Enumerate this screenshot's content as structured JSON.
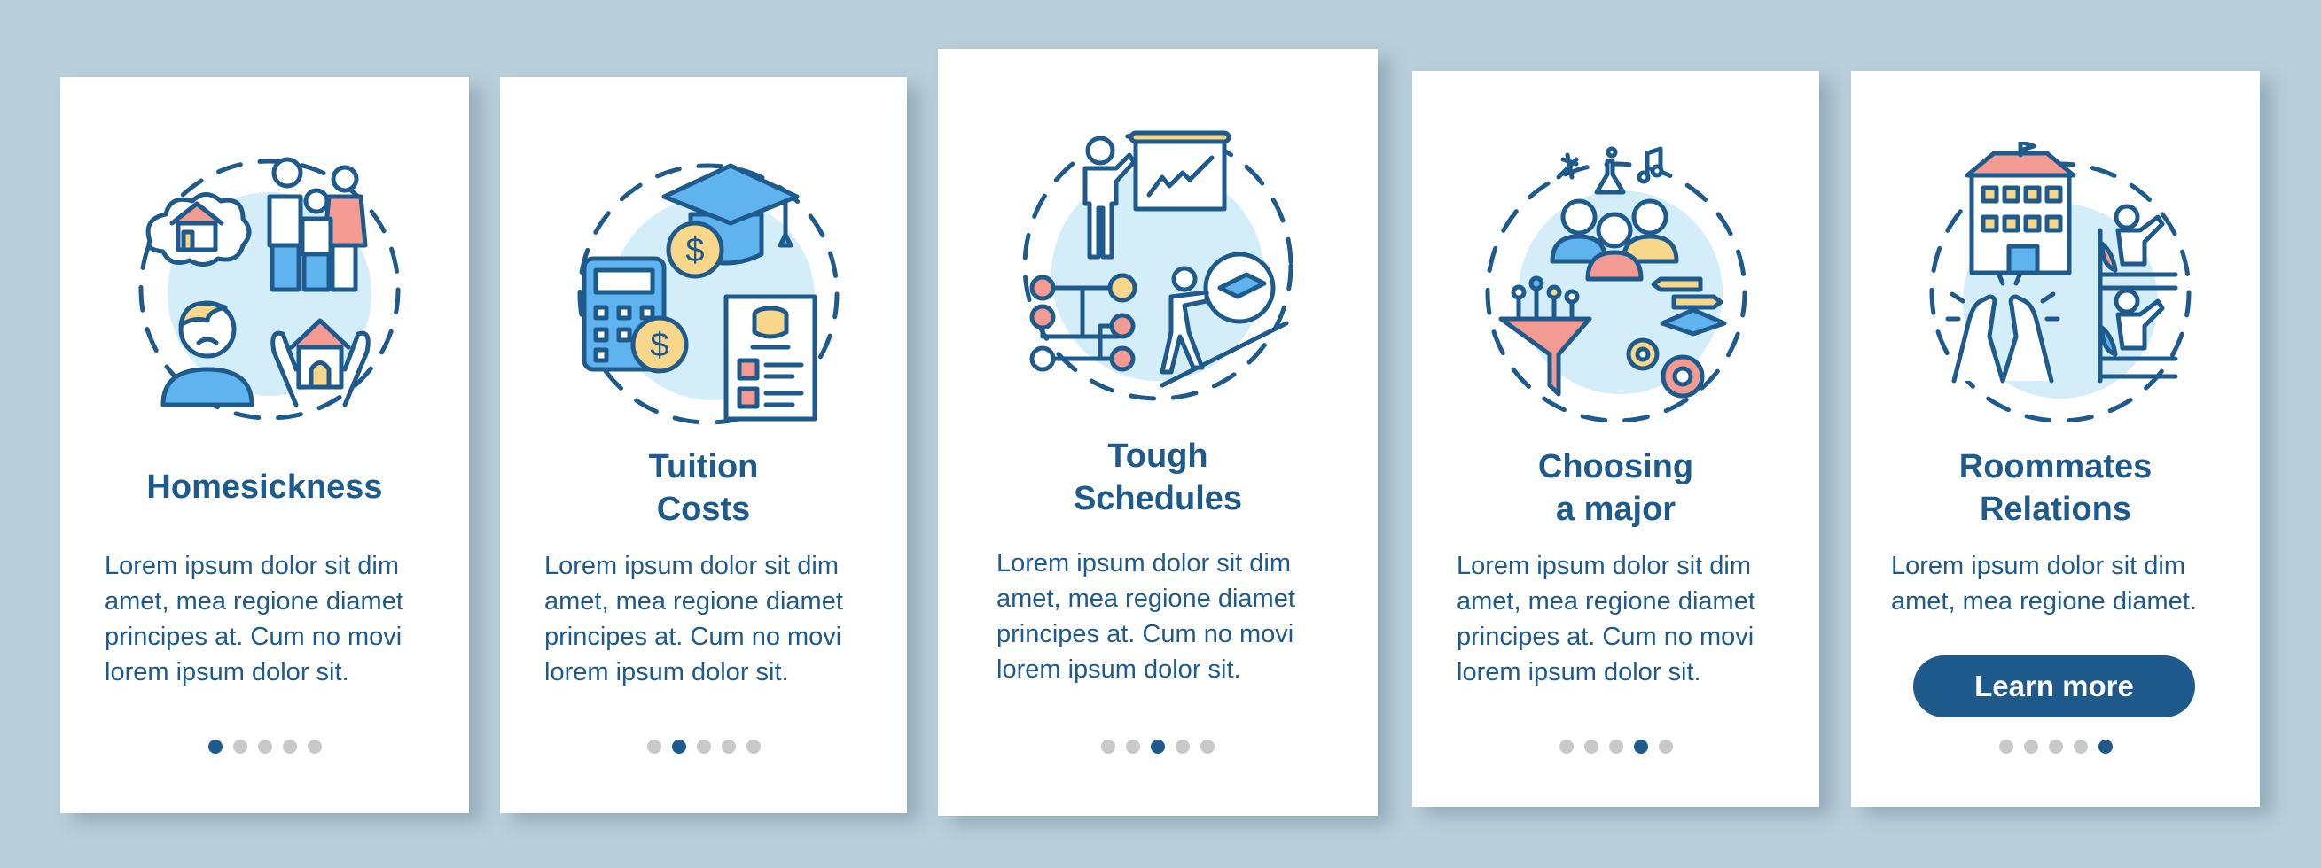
{
  "colors": {
    "background": "#b9cfdb",
    "primary": "#1f5a8c",
    "dot_inactive": "#c9c9c9",
    "illustration_circle": "#d3eef9",
    "accent_blue": "#5fb4f0",
    "accent_pink": "#f39a92",
    "accent_yellow": "#f8d78a"
  },
  "screens": [
    {
      "title": "Homesickness",
      "body": "Lorem ipsum dolor sit dim\namet, mea regione diamet\nprincipes at. Cum no movi\nlorem ipsum dolor sit.",
      "illustration": "homesickness-illustration",
      "active_page": 1,
      "total_pages": 5
    },
    {
      "title": "Tuition\nCosts",
      "body": "Lorem ipsum dolor sit dim\namet, mea regione diamet\nprincipes at. Cum no movi\nlorem ipsum dolor sit.",
      "illustration": "tuition-costs-illustration",
      "active_page": 2,
      "total_pages": 5
    },
    {
      "title": "Tough\nSchedules",
      "body": "Lorem ipsum dolor sit dim\namet, mea regione diamet\nprincipes at. Cum no movi\nlorem ipsum dolor sit.",
      "illustration": "tough-schedules-illustration",
      "active_page": 3,
      "total_pages": 5
    },
    {
      "title": "Choosing\na major",
      "body": "Lorem ipsum dolor sit dim\namet, mea regione diamet\nprincipes at. Cum no movi\nlorem ipsum dolor sit.",
      "illustration": "choosing-major-illustration",
      "active_page": 4,
      "total_pages": 5
    },
    {
      "title": "Roommates\nRelations",
      "body": "Lorem ipsum dolor sit dim\namet, mea regione diamet.",
      "illustration": "roommates-illustration",
      "button_label": "Learn more",
      "active_page": 5,
      "total_pages": 5
    }
  ]
}
